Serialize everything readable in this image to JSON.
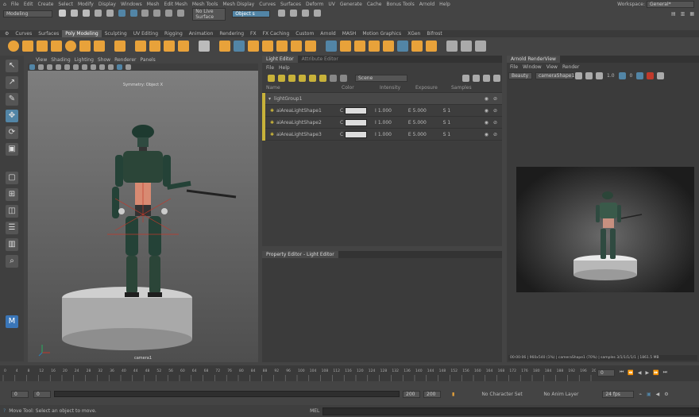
{
  "menubar": {
    "items": [
      "File",
      "Edit",
      "Create",
      "Select",
      "Modify",
      "Display",
      "Windows",
      "Mesh",
      "Edit Mesh",
      "Mesh Tools",
      "Mesh Display",
      "Curves",
      "Surfaces",
      "Deform",
      "UV",
      "Generate",
      "Cache",
      "Bonus Tools",
      "Arnold",
      "Help"
    ],
    "workspace_label": "Workspace:",
    "workspace_value": "General*"
  },
  "statusline": {
    "menuset": "Modeling",
    "live_surface": "No Live Surface",
    "objects_field": "Object s"
  },
  "shelf": {
    "tabs": [
      "Curves",
      "Surfaces",
      "Poly Modeling",
      "Sculpting",
      "UV Editing",
      "Rigging",
      "Animation",
      "Rendering",
      "FX",
      "FX Caching",
      "Custom",
      "Arnold",
      "MASH",
      "Motion Graphics",
      "XGen",
      "Bifrost"
    ],
    "active_tab": "Poly Modeling"
  },
  "viewport": {
    "menus": [
      "View",
      "Shading",
      "Lighting",
      "Show",
      "Renderer",
      "Panels"
    ],
    "symmetry_label": "Symmetry: Object X",
    "camera_label": "camera1"
  },
  "light_editor": {
    "tabs": [
      "Light Editor",
      "Attribute Editor"
    ],
    "menus": [
      "File",
      "Help"
    ],
    "scene_dropdown": "Scene",
    "columns": [
      "Name",
      "Color",
      "Intensity",
      "Exposure",
      "Samples"
    ],
    "group_name": "lightGroup1",
    "lights": [
      {
        "name": "aiAreaLightShape1",
        "color_label": "C",
        "intensity": "1.000",
        "exposure": "5.000",
        "samples": "1"
      },
      {
        "name": "aiAreaLightShape2",
        "color_label": "C",
        "intensity": "1.000",
        "exposure": "5.000",
        "samples": "1"
      },
      {
        "name": "aiAreaLightShape3",
        "color_label": "C",
        "intensity": "1.000",
        "exposure": "5.000",
        "samples": "1"
      }
    ],
    "intensity_prefix": "I",
    "exposure_prefix": "E",
    "samples_prefix": "S"
  },
  "property_editor": {
    "title": "Property Editor - Light Editor"
  },
  "arnold": {
    "title": "Arnold RenderView",
    "menus": [
      "File",
      "Window",
      "View",
      "Render"
    ],
    "beauty": "Beauty",
    "camera": "cameraShape1",
    "frame_value": "1.0",
    "zoom_value": "0",
    "status_text": "00:00:06 | 960x540 (1%) | cameraShape1 (70%) | samples 3/1/1/1/1/1 | 1861.5 MB"
  },
  "timeline": {
    "ticks": [
      "0",
      "4",
      "8",
      "12",
      "16",
      "20",
      "24",
      "28",
      "32",
      "36",
      "40",
      "44",
      "48",
      "52",
      "56",
      "60",
      "64",
      "68",
      "72",
      "76",
      "80",
      "84",
      "88",
      "92",
      "96",
      "100",
      "104",
      "108",
      "112",
      "116",
      "120",
      "124",
      "128",
      "132",
      "136",
      "140",
      "144",
      "148",
      "152",
      "156",
      "160",
      "164",
      "168",
      "172",
      "176",
      "180",
      "184",
      "188",
      "192",
      "196",
      "200"
    ],
    "current_frame": "0"
  },
  "range": {
    "start": "0",
    "start2": "0",
    "end1": "200",
    "end2": "200",
    "character_set": "No Character Set",
    "anim_layer": "No Anim Layer",
    "fps": "24 fps"
  },
  "status": {
    "help_text": "Move Tool: Select an object to move.",
    "mel_label": "MEL"
  },
  "colors": {
    "accent_yellow": "#c8b23a",
    "selection_blue": "#5285a6",
    "shelf_orange": "#e8a23a"
  }
}
